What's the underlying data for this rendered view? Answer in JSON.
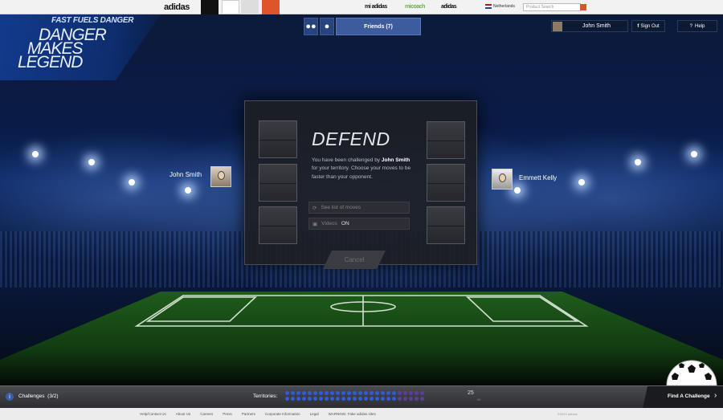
{
  "top_bar": {
    "brand": "adidas",
    "sub_brands": [
      "mi adidas",
      "micoach",
      "adidas"
    ],
    "region": "Netherlands",
    "search_placeholder": "Product Search"
  },
  "logo": {
    "kicker": "FAST FUELS DANGER",
    "lines": [
      "DANGER",
      "MAKES",
      "LEGEND"
    ]
  },
  "header": {
    "friends_tab_label": "Friends (7)",
    "user_name": "John Smith",
    "sign_out_label": "Sign Out",
    "help_label": "Help"
  },
  "players": {
    "left_name": "John Smith",
    "right_name": "Emmett Kelly"
  },
  "dialog": {
    "title": "DEFEND",
    "text_before": "You have been challenged by ",
    "challenger": "John Smith",
    "text_after": " for your territory. Choose your moves to be faster than your opponent.",
    "moves_option": "See list of moves",
    "videos_label": "Videos",
    "videos_state": "ON",
    "cancel_label": "Cancel"
  },
  "bottom_bar": {
    "challenges_label": "Challenges",
    "challenges_count": "(3/2)",
    "territories_label": "Territories:",
    "territories_value": "25",
    "territories_total": "50",
    "territories_blue": 20,
    "territories_purple": 5,
    "find_challenge_label": "Find A Challenge"
  },
  "footer": {
    "links": [
      "Help/Contact Us",
      "About Us",
      "Careers",
      "Press",
      "Partners",
      "Corporate Information",
      "Legal",
      "WARNING: Fake adidas sites"
    ],
    "copyright": "©2010 adidas"
  },
  "colors": {
    "accent_blue": "#3d5c9e",
    "territory_blue": "#2f5bd8",
    "territory_purple": "#5a3f9a",
    "search_button": "#e0542b"
  }
}
